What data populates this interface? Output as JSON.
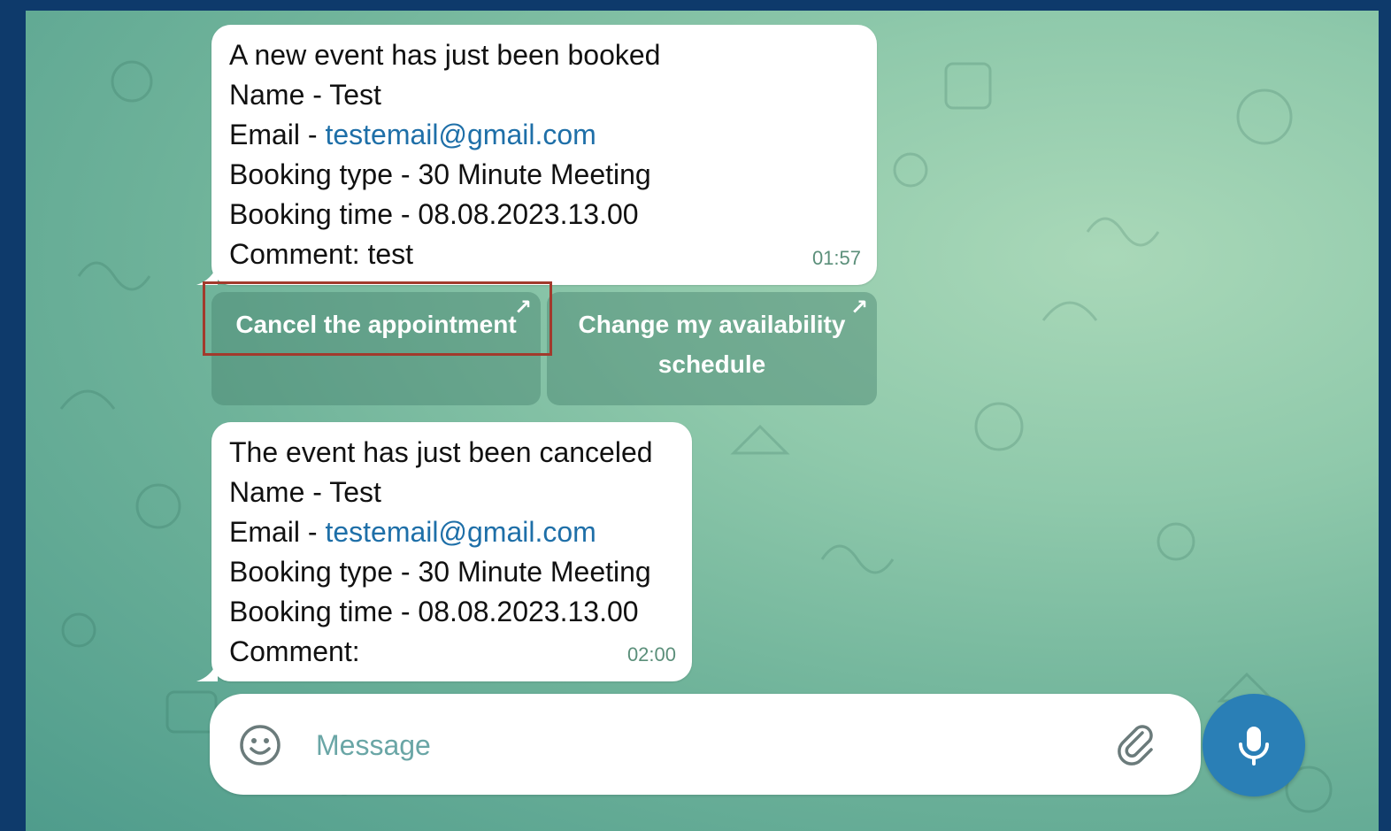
{
  "colors": {
    "frame": "#0e3a6b",
    "chat_background": "#8fc9ab",
    "bubble": "#ffffff",
    "link": "#1e6fa8",
    "timestamp": "#5b8f7a",
    "mic_button": "#2a7fb6",
    "highlight_border": "#a23a2c"
  },
  "messages": [
    {
      "title": "A new event has just been booked",
      "name": "Name - Test",
      "email_prefix": "Email - ",
      "email": "testemail@gmail.com",
      "booking_type": "Booking type - 30 Minute Meeting",
      "booking_time": "Booking time - 08.08.2023.13.00",
      "comment": "Comment: test",
      "time": "01:57"
    },
    {
      "title": "The event has just been canceled",
      "name": "Name - Test",
      "email_prefix": "Email - ",
      "email": "testemail@gmail.com",
      "booking_type": "Booking type - 30 Minute Meeting",
      "booking_time": "Booking time - 08.08.2023.13.00",
      "comment": "Comment:",
      "time": "02:00"
    }
  ],
  "inline_buttons": [
    {
      "label": "Cancel the appointment",
      "icon": "external-link-arrow-icon"
    },
    {
      "label_line1": "Change my availability",
      "label_line2": "schedule",
      "icon": "external-link-arrow-icon"
    }
  ],
  "composer": {
    "placeholder": "Message",
    "emoji_icon": "smiley-icon",
    "attach_icon": "paperclip-icon",
    "mic_icon": "microphone-icon"
  }
}
